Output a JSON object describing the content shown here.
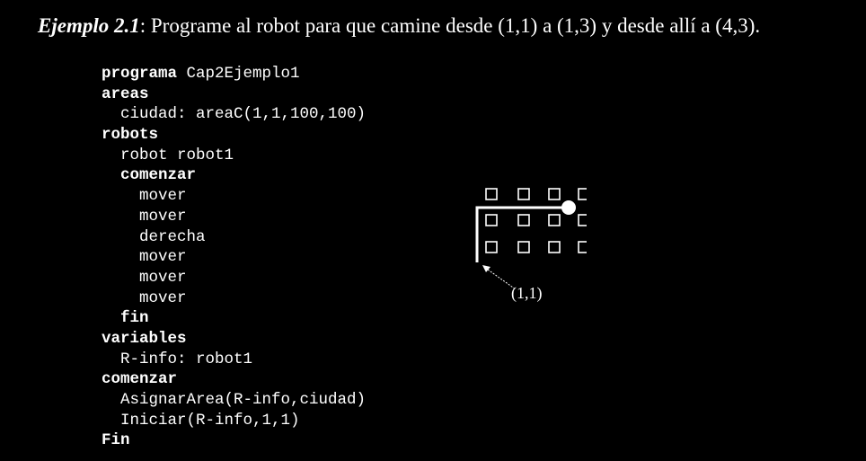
{
  "heading": {
    "label": "Ejemplo 2.1",
    "text": ": Programe al robot para que camine desde (1,1) a (1,3) y desde allí a (4,3)."
  },
  "code_lines": [
    {
      "indent": "",
      "text": "programa",
      "bold": true,
      "rest": " Cap2Ejemplo1"
    },
    {
      "indent": "",
      "text": "areas",
      "bold": true,
      "rest": ""
    },
    {
      "indent": "  ",
      "text": "ciudad: areaC(1,1,100,100)",
      "bold": false,
      "rest": ""
    },
    {
      "indent": "",
      "text": "robots",
      "bold": true,
      "rest": ""
    },
    {
      "indent": "  ",
      "text": "robot robot1",
      "bold": false,
      "rest": ""
    },
    {
      "indent": "  ",
      "text": "comenzar",
      "bold": true,
      "rest": ""
    },
    {
      "indent": "    ",
      "text": "mover",
      "bold": false,
      "rest": ""
    },
    {
      "indent": "    ",
      "text": "mover",
      "bold": false,
      "rest": ""
    },
    {
      "indent": "    ",
      "text": "derecha",
      "bold": false,
      "rest": ""
    },
    {
      "indent": "    ",
      "text": "mover",
      "bold": false,
      "rest": ""
    },
    {
      "indent": "    ",
      "text": "mover",
      "bold": false,
      "rest": ""
    },
    {
      "indent": "    ",
      "text": "mover",
      "bold": false,
      "rest": ""
    },
    {
      "indent": "  ",
      "text": "fin",
      "bold": true,
      "rest": ""
    },
    {
      "indent": "",
      "text": "variables",
      "bold": true,
      "rest": ""
    },
    {
      "indent": "  ",
      "text": "R-info: robot1",
      "bold": false,
      "rest": ""
    },
    {
      "indent": "",
      "text": "comenzar",
      "bold": true,
      "rest": ""
    },
    {
      "indent": "  ",
      "text": "AsignarArea(R-info,ciudad)",
      "bold": false,
      "rest": ""
    },
    {
      "indent": "  ",
      "text": "Iniciar(R-info,1,1)",
      "bold": false,
      "rest": ""
    },
    {
      "indent": "",
      "text": "Fin",
      "bold": true,
      "rest": ""
    }
  ],
  "diagram": {
    "start_label": "(1,1)"
  }
}
